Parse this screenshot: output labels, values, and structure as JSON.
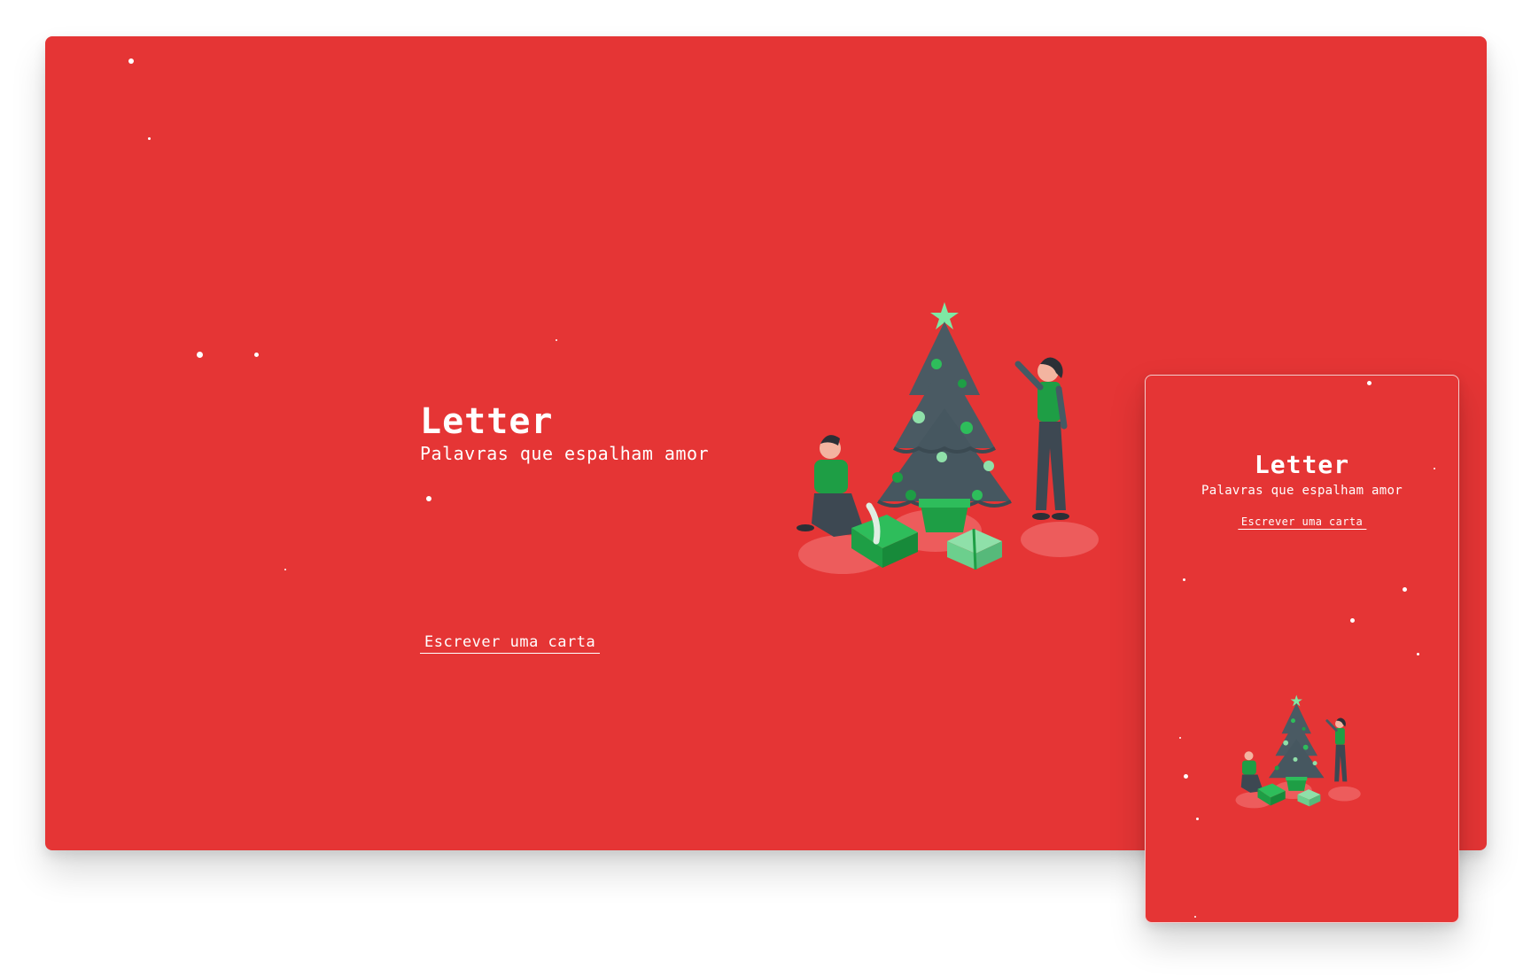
{
  "colors": {
    "background": "#e53535",
    "text": "#ffffff",
    "page": "#ffffff",
    "accent_green": "#1e9e45",
    "tree_dark": "#455a64"
  },
  "desktop": {
    "title": "Letter",
    "subtitle": "Palavras que espalham amor",
    "cta_label": "Escrever uma carta",
    "illustration": "christmas-tree-couple-illustration"
  },
  "mobile": {
    "title": "Letter",
    "subtitle": "Palavras que espalham amor",
    "cta_label": "Escrever uma carta",
    "illustration": "christmas-tree-couple-illustration"
  },
  "decorations": {
    "snow_icon": "snowflake-dot-icon"
  }
}
